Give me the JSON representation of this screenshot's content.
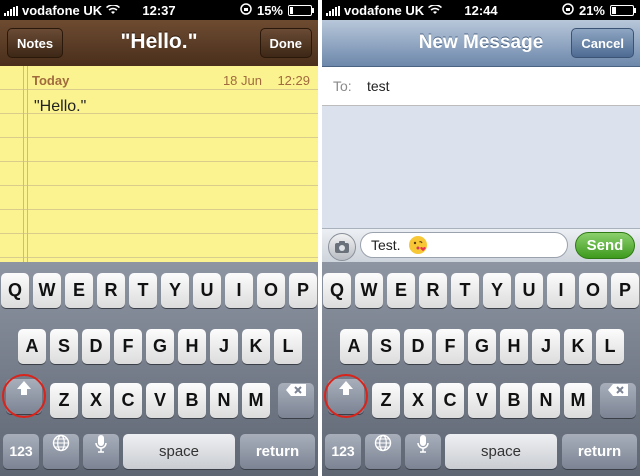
{
  "left": {
    "status": {
      "carrier": "vodafone UK",
      "time": "12:37",
      "battery": "15%",
      "battery_level": 0.15
    },
    "navbar": {
      "back": "Notes",
      "title": "\"Hello.\"",
      "done": "Done"
    },
    "note": {
      "day": "Today",
      "date": "18 Jun",
      "time": "12:29",
      "body": "\"Hello.\""
    },
    "keyboard": {
      "row1": [
        "Q",
        "W",
        "E",
        "R",
        "T",
        "Y",
        "U",
        "I",
        "O",
        "P"
      ],
      "row2": [
        "A",
        "S",
        "D",
        "F",
        "G",
        "H",
        "J",
        "K",
        "L"
      ],
      "row3": [
        "Z",
        "X",
        "C",
        "V",
        "B",
        "N",
        "M"
      ],
      "numbers": "123",
      "space": "space",
      "return": "return"
    }
  },
  "right": {
    "status": {
      "carrier": "vodafone UK",
      "time": "12:44",
      "battery": "21%",
      "battery_level": 0.21
    },
    "navbar": {
      "title": "New Message",
      "cancel": "Cancel"
    },
    "to": {
      "label": "To:",
      "value": "test"
    },
    "compose": {
      "text": "Test.",
      "send": "Send"
    },
    "keyboard": {
      "row1": [
        "Q",
        "W",
        "E",
        "R",
        "T",
        "Y",
        "U",
        "I",
        "O",
        "P"
      ],
      "row2": [
        "A",
        "S",
        "D",
        "F",
        "G",
        "H",
        "J",
        "K",
        "L"
      ],
      "row3": [
        "Z",
        "X",
        "C",
        "V",
        "B",
        "N",
        "M"
      ],
      "numbers": "123",
      "space": "space",
      "return": "return"
    }
  }
}
